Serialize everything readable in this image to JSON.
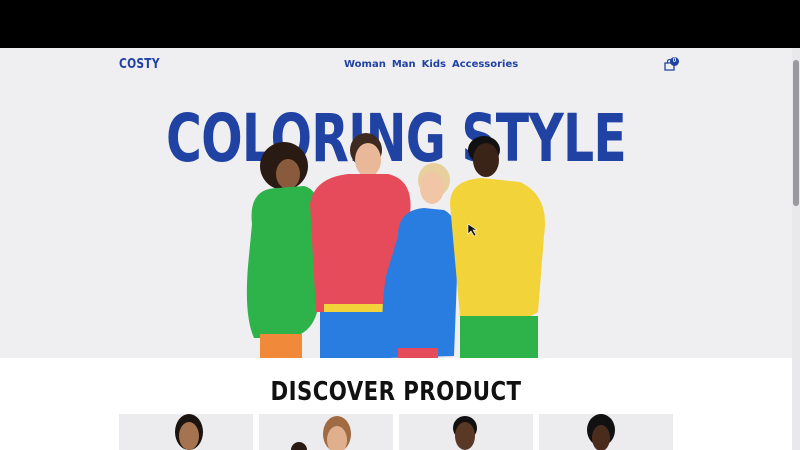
{
  "header": {
    "logo": "COSTY",
    "nav": [
      "Woman",
      "Man",
      "Kids",
      "Accessories"
    ],
    "cart_count": "0",
    "cart_icon": "shopping-bag-icon"
  },
  "hero": {
    "title": "COLORING STYLE",
    "image": "four-models-in-colorful-hoodies"
  },
  "discover": {
    "title": "DISCOVER PRODUCT",
    "cards": [
      "product-model-1",
      "product-model-2",
      "product-model-3",
      "product-model-4"
    ]
  },
  "colors": {
    "brand": "#2042a3",
    "background": "#efeef1",
    "green": "#2db34a",
    "red": "#e54b5a",
    "blue": "#2a7de0",
    "yellow": "#f2d43a"
  }
}
